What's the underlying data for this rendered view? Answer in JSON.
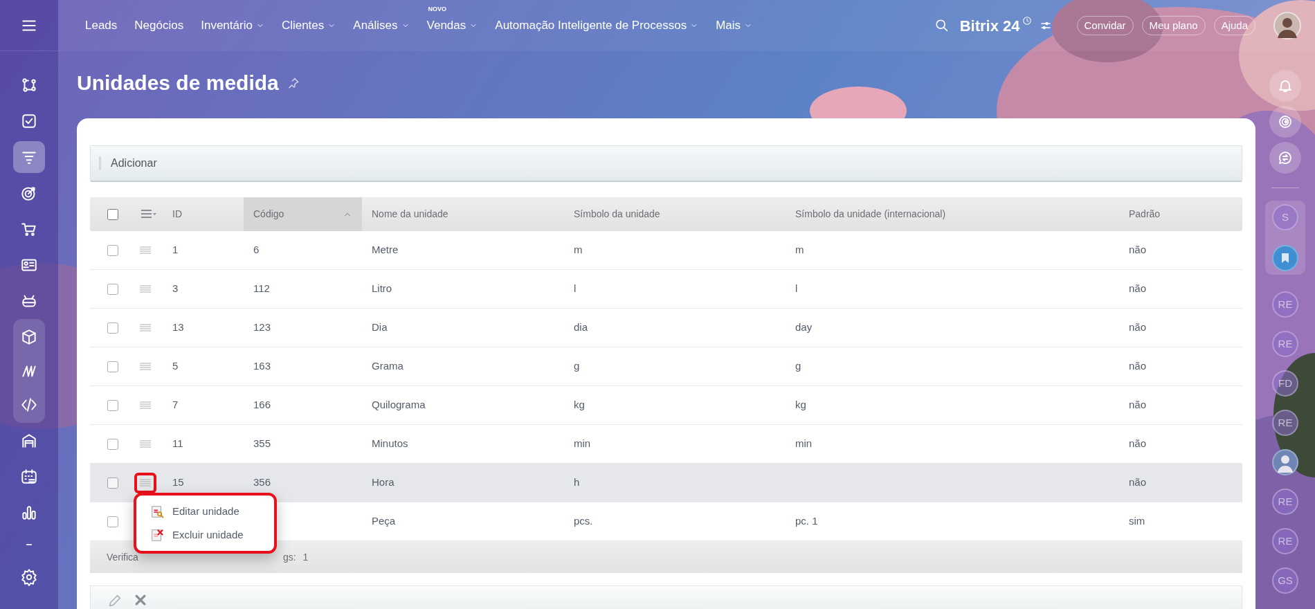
{
  "topbar": {
    "nav": [
      {
        "label": "Leads",
        "dropdown": false
      },
      {
        "label": "Negócios",
        "dropdown": false
      },
      {
        "label": "Inventário",
        "dropdown": true
      },
      {
        "label": "Clientes",
        "dropdown": true
      },
      {
        "label": "Análises",
        "dropdown": true
      },
      {
        "label": "Vendas",
        "dropdown": true,
        "badge": "NOVO"
      },
      {
        "label": "Automação Inteligente de Processos",
        "dropdown": true
      },
      {
        "label": "Mais",
        "dropdown": true
      }
    ],
    "logo": "Bitrix 24",
    "buttons": [
      "Convidar",
      "Meu plano",
      "Ajuda"
    ]
  },
  "left_sidebar": {
    "items": [
      {
        "kind": "flow",
        "selected": false,
        "grouped": false
      },
      {
        "kind": "tasks",
        "selected": false,
        "grouped": false
      },
      {
        "kind": "funnel",
        "selected": true,
        "grouped": false
      },
      {
        "kind": "target",
        "selected": false,
        "grouped": false
      },
      {
        "kind": "cart",
        "selected": false,
        "grouped": false
      },
      {
        "kind": "card",
        "selected": false,
        "grouped": false
      },
      {
        "kind": "robot",
        "selected": false,
        "grouped": false
      },
      {
        "kind": "cube",
        "selected": false,
        "grouped": true
      },
      {
        "kind": "wave",
        "selected": false,
        "grouped": true
      },
      {
        "kind": "code",
        "selected": false,
        "grouped": true
      },
      {
        "kind": "warehouse",
        "selected": false,
        "grouped": false
      },
      {
        "kind": "calendar",
        "selected": false,
        "grouped": false
      },
      {
        "kind": "chart",
        "selected": false,
        "grouped": false
      },
      {
        "kind": "dash",
        "selected": false,
        "grouped": false
      },
      {
        "kind": "settings",
        "selected": false,
        "grouped": false
      }
    ]
  },
  "page": {
    "title": "Unidades de medida"
  },
  "toolbar": {
    "button": "Adicionar"
  },
  "table": {
    "select_all": {
      "checked": false
    },
    "columns": [
      {
        "label": "ID",
        "sorted": false
      },
      {
        "label": "Código",
        "sorted": true
      },
      {
        "label": "Nome da unidade",
        "sorted": false
      },
      {
        "label": "Símbolo da unidade",
        "sorted": false
      },
      {
        "label": "Símbolo da unidade (internacional)",
        "sorted": false
      },
      {
        "label": "Padrão",
        "sorted": false
      }
    ],
    "rows": [
      {
        "checked": false,
        "selected": false,
        "menu_open": false,
        "id": "1",
        "code": "6",
        "name": "Metre",
        "symbol": "m",
        "symbol_intl": "m",
        "default": "não"
      },
      {
        "checked": false,
        "selected": false,
        "menu_open": false,
        "id": "3",
        "code": "112",
        "name": "Litro",
        "symbol": "l",
        "symbol_intl": "l",
        "default": "não"
      },
      {
        "checked": false,
        "selected": false,
        "menu_open": false,
        "id": "13",
        "code": "123",
        "name": "Dia",
        "symbol": "dia",
        "symbol_intl": "day",
        "default": "não"
      },
      {
        "checked": false,
        "selected": false,
        "menu_open": false,
        "id": "5",
        "code": "163",
        "name": "Grama",
        "symbol": "g",
        "symbol_intl": "g",
        "default": "não"
      },
      {
        "checked": false,
        "selected": false,
        "menu_open": false,
        "id": "7",
        "code": "166",
        "name": "Quilograma",
        "symbol": "kg",
        "symbol_intl": "kg",
        "default": "não"
      },
      {
        "checked": false,
        "selected": false,
        "menu_open": false,
        "id": "11",
        "code": "355",
        "name": "Minutos",
        "symbol": "min",
        "symbol_intl": "min",
        "default": "não"
      },
      {
        "checked": false,
        "selected": true,
        "menu_open": true,
        "id": "15",
        "code": "356",
        "name": "Hora",
        "symbol": "h",
        "default": "não"
      },
      {
        "checked": false,
        "selected": false,
        "name": "Peça",
        "symbol": "pcs.",
        "symbol_intl": "pc. 1",
        "default": "sim"
      }
    ],
    "footer": {
      "label": "Verifica",
      "label_tail": "gs:",
      "count": "1"
    }
  },
  "context_menu": {
    "items": [
      {
        "kind": "edit",
        "label": "Editar unidade"
      },
      {
        "kind": "delete",
        "label": "Excluir unidade"
      }
    ]
  },
  "right_sidebar": {
    "items": [
      {
        "kind": "bell",
        "grouped": false
      },
      {
        "kind": "copilot",
        "grouped": false
      },
      {
        "kind": "chat",
        "grouped": false
      },
      {
        "kind": "initials",
        "text": "S",
        "grouped": true
      },
      {
        "kind": "bookmark",
        "grouped": true
      },
      {
        "kind": "initials",
        "text": "RE",
        "grouped": false
      },
      {
        "kind": "initials",
        "text": "RE",
        "grouped": false
      },
      {
        "kind": "initials",
        "text": "FD",
        "grouped": false
      },
      {
        "kind": "initials",
        "text": "RE",
        "grouped": false
      },
      {
        "kind": "avatar",
        "grouped": false
      },
      {
        "kind": "initials",
        "text": "RE",
        "grouped": false
      },
      {
        "kind": "initials",
        "text": "RE",
        "grouped": false
      },
      {
        "kind": "initials",
        "text": "GS",
        "grouped": false
      }
    ]
  }
}
